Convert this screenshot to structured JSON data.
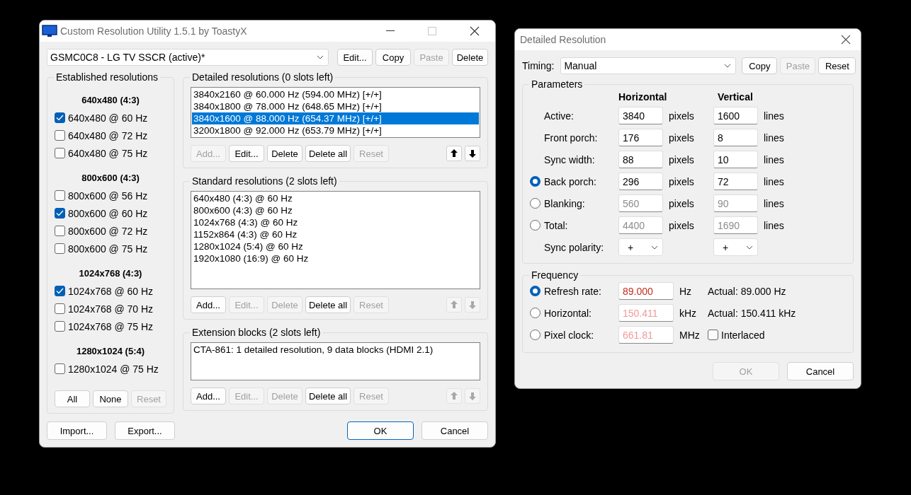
{
  "main_window": {
    "title": "Custom Resolution Utility 1.5.1 by ToastyX",
    "device_select": "GSMC0C8 - LG TV SSCR (active)*",
    "device_buttons": [
      {
        "label": "Edit...",
        "disabled": false
      },
      {
        "label": "Copy",
        "disabled": false
      },
      {
        "label": "Paste",
        "disabled": true
      },
      {
        "label": "Delete",
        "disabled": false
      }
    ],
    "established": {
      "title": "Established resolutions",
      "groups": [
        {
          "heading": "640x480 (4:3)",
          "items": [
            {
              "label": "640x480 @ 60 Hz",
              "checked": true
            },
            {
              "label": "640x480 @ 72 Hz",
              "checked": false
            },
            {
              "label": "640x480 @ 75 Hz",
              "checked": false
            }
          ]
        },
        {
          "heading": "800x600 (4:3)",
          "items": [
            {
              "label": "800x600 @ 56 Hz",
              "checked": false
            },
            {
              "label": "800x600 @ 60 Hz",
              "checked": true
            },
            {
              "label": "800x600 @ 72 Hz",
              "checked": false
            },
            {
              "label": "800x600 @ 75 Hz",
              "checked": false
            }
          ]
        },
        {
          "heading": "1024x768 (4:3)",
          "items": [
            {
              "label": "1024x768 @ 60 Hz",
              "checked": true
            },
            {
              "label": "1024x768 @ 70 Hz",
              "checked": false
            },
            {
              "label": "1024x768 @ 75 Hz",
              "checked": false
            }
          ]
        },
        {
          "heading": "1280x1024 (5:4)",
          "items": [
            {
              "label": "1280x1024 @ 75 Hz",
              "checked": false
            }
          ]
        }
      ],
      "buttons": [
        {
          "label": "All",
          "disabled": false
        },
        {
          "label": "None",
          "disabled": false
        },
        {
          "label": "Reset",
          "disabled": true
        }
      ]
    },
    "lists": [
      {
        "title": "Detailed resolutions (0 slots left)",
        "items": [
          {
            "label": "3840x2160 @ 60.000 Hz (594.00 MHz) [+/+]",
            "selected": false
          },
          {
            "label": "3840x1800 @ 78.000 Hz (648.65 MHz) [+/+]",
            "selected": false
          },
          {
            "label": "3840x1600 @ 88.000 Hz (654.37 MHz) [+/+]",
            "selected": true
          },
          {
            "label": "3200x1800 @ 92.000 Hz (653.79 MHz) [+/+]",
            "selected": false
          }
        ],
        "buttons": [
          {
            "label": "Add...",
            "disabled": true
          },
          {
            "label": "Edit...",
            "disabled": false
          },
          {
            "label": "Delete",
            "disabled": false
          },
          {
            "label": "Delete all",
            "disabled": false
          },
          {
            "label": "Reset",
            "disabled": true
          }
        ],
        "arrows": [
          {
            "kind": "up",
            "disabled": false
          },
          {
            "kind": "down",
            "disabled": false
          }
        ]
      },
      {
        "title": "Standard resolutions (2 slots left)",
        "items": [
          {
            "label": "640x480 (4:3) @ 60 Hz",
            "selected": false
          },
          {
            "label": "800x600 (4:3) @ 60 Hz",
            "selected": false
          },
          {
            "label": "1024x768 (4:3) @ 60 Hz",
            "selected": false
          },
          {
            "label": "1152x864 (4:3) @ 60 Hz",
            "selected": false
          },
          {
            "label": "1280x1024 (5:4) @ 60 Hz",
            "selected": false
          },
          {
            "label": "1920x1080 (16:9) @ 60 Hz",
            "selected": false
          }
        ],
        "buttons": [
          {
            "label": "Add...",
            "disabled": false
          },
          {
            "label": "Edit...",
            "disabled": true
          },
          {
            "label": "Delete",
            "disabled": true
          },
          {
            "label": "Delete all",
            "disabled": false
          },
          {
            "label": "Reset",
            "disabled": true
          }
        ],
        "arrows": [
          {
            "kind": "up",
            "disabled": true
          },
          {
            "kind": "down",
            "disabled": true
          }
        ]
      },
      {
        "title": "Extension blocks (2 slots left)",
        "items": [
          {
            "label": "CTA-861: 1 detailed resolution, 9 data blocks (HDMI 2.1)",
            "selected": false
          }
        ],
        "buttons": [
          {
            "label": "Add...",
            "disabled": false
          },
          {
            "label": "Edit...",
            "disabled": true
          },
          {
            "label": "Delete",
            "disabled": true
          },
          {
            "label": "Delete all",
            "disabled": false
          },
          {
            "label": "Reset",
            "disabled": true
          }
        ],
        "arrows": [
          {
            "kind": "up",
            "disabled": true
          },
          {
            "kind": "down",
            "disabled": true
          }
        ]
      }
    ],
    "footer_left": [
      {
        "label": "Import...",
        "default": false
      },
      {
        "label": "Export...",
        "default": false
      }
    ],
    "footer_right": [
      {
        "label": "OK",
        "default": true
      },
      {
        "label": "Cancel",
        "default": false
      }
    ]
  },
  "detail_window": {
    "title": "Detailed Resolution",
    "timing_label": "Timing:",
    "timing_value": "Manual",
    "buttons": [
      {
        "label": "Copy",
        "disabled": false
      },
      {
        "label": "Paste",
        "disabled": true
      },
      {
        "label": "Reset",
        "disabled": false
      }
    ],
    "parameters": {
      "title": "Parameters",
      "headings": [
        "Horizontal",
        "Vertical"
      ],
      "rows": [
        {
          "kind": "plain",
          "label": "Active:",
          "h_value": "3840",
          "h_unit": "pixels",
          "v_value": "1600",
          "v_unit": "lines",
          "disabled": false
        },
        {
          "kind": "plain",
          "label": "Front porch:",
          "h_value": "176",
          "h_unit": "pixels",
          "v_value": "8",
          "v_unit": "lines",
          "disabled": false
        },
        {
          "kind": "plain",
          "label": "Sync width:",
          "h_value": "88",
          "h_unit": "pixels",
          "v_value": "10",
          "v_unit": "lines",
          "disabled": false
        },
        {
          "kind": "radio",
          "selected": true,
          "label": "Back porch:",
          "h_value": "296",
          "h_unit": "pixels",
          "v_value": "72",
          "v_unit": "lines",
          "disabled": false
        },
        {
          "kind": "radio",
          "selected": false,
          "label": "Blanking:",
          "h_value": "560",
          "h_unit": "pixels",
          "v_value": "90",
          "v_unit": "lines",
          "disabled": true
        },
        {
          "kind": "radio",
          "selected": false,
          "label": "Total:",
          "h_value": "4400",
          "h_unit": "pixels",
          "v_value": "1690",
          "v_unit": "lines",
          "disabled": true
        }
      ],
      "polarity": {
        "label": "Sync polarity:",
        "h": "+",
        "v": "+"
      }
    },
    "frequency": {
      "title": "Frequency",
      "rows": [
        {
          "label": "Refresh rate:",
          "selected": true,
          "value": "89.000",
          "unit": "Hz",
          "disabled": false,
          "extra": {
            "kind": "text",
            "text": "Actual: 89.000 Hz"
          }
        },
        {
          "label": "Horizontal:",
          "selected": false,
          "value": "150.411",
          "unit": "kHz",
          "disabled": true,
          "extra": {
            "kind": "text",
            "text": "Actual: 150.411 kHz"
          }
        },
        {
          "label": "Pixel clock:",
          "selected": false,
          "value": "661.81",
          "unit": "MHz",
          "disabled": true,
          "extra": {
            "kind": "checkbox",
            "text": "Interlaced",
            "checked": false
          }
        }
      ]
    },
    "footer": [
      {
        "label": "OK",
        "disabled": true
      },
      {
        "label": "Cancel",
        "disabled": false
      }
    ]
  }
}
